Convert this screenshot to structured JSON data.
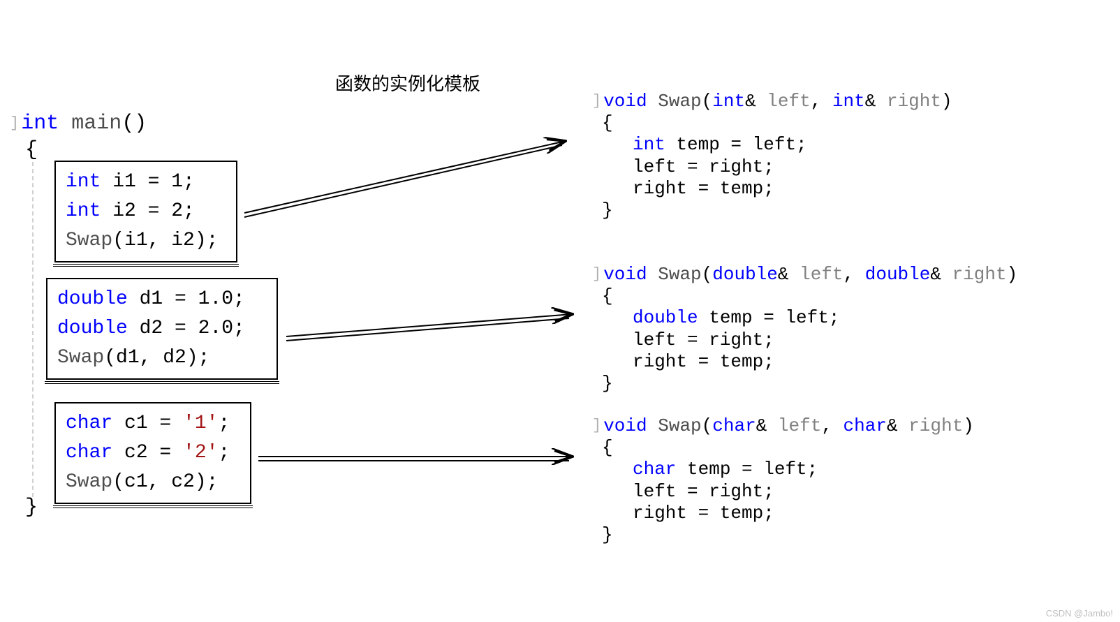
{
  "title": "函数的实例化模板",
  "main": {
    "signature_kw": "int",
    "signature_fn": "main",
    "signature_paren": "()"
  },
  "blocks": [
    {
      "line1_kw": "int",
      "line1_var": " i1 = 1;",
      "line2_kw": "int",
      "line2_var": " i2 = 2;",
      "line3_fn": "Swap",
      "line3_args": "(i1, i2);"
    },
    {
      "line1_kw": "double",
      "line1_var": " d1 = 1.0;",
      "line2_kw": "double",
      "line2_var": " d2 = 2.0;",
      "line3_fn": "Swap",
      "line3_args": "(d1, d2);"
    },
    {
      "line1_kw": "char",
      "line1_var1": " c1 = ",
      "line1_str": "'1'",
      "line1_end": ";",
      "line2_kw": "char",
      "line2_var1": " c2 = ",
      "line2_str": "'2'",
      "line2_end": ";",
      "line3_fn": "Swap",
      "line3_args": "(c1, c2);"
    }
  ],
  "funcs": [
    {
      "ret": "void",
      "name": "Swap",
      "ptype": "int",
      "body1_kw": "int",
      "body1_rest": " temp = left;",
      "body2": "left = right;",
      "body3": "right = temp;"
    },
    {
      "ret": "void",
      "name": "Swap",
      "ptype": "double",
      "body1_kw": "double",
      "body1_rest": " temp = left;",
      "body2": "left = right;",
      "body3": "right = temp;"
    },
    {
      "ret": "void",
      "name": "Swap",
      "ptype": "char",
      "body1_kw": "char",
      "body1_rest": " temp = left;",
      "body2": "left = right;",
      "body3": "right = temp;"
    }
  ],
  "sym": {
    "amp": "&",
    "left": "left",
    "right": "right",
    "comma": ", ",
    "open": "(",
    "close": ")",
    "lbrace": "{",
    "rbrace": "}"
  },
  "watermark": "CSDN @Jambo!"
}
